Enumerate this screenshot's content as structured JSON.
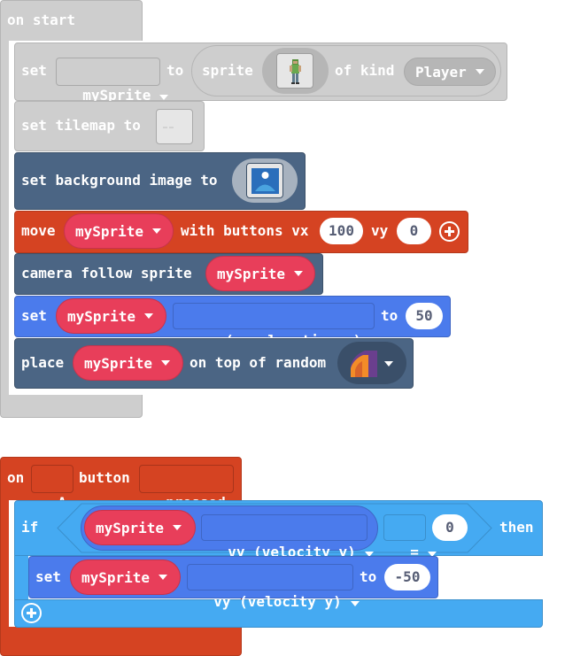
{
  "on_start": {
    "hat_label": "on start",
    "set_sprite": {
      "set": "set",
      "variable": "mySprite",
      "to": "to",
      "sprite": "sprite",
      "of_kind": "of kind",
      "kind": "Player"
    },
    "set_tilemap": {
      "label": "set tilemap to"
    },
    "set_background": {
      "label": "set background image to"
    },
    "move": {
      "move": "move",
      "variable": "mySprite",
      "with_buttons": "with buttons vx",
      "vx": "100",
      "vy_label": "vy",
      "vy": "0"
    },
    "camera": {
      "label": "camera follow sprite",
      "variable": "mySprite"
    },
    "set_ay": {
      "set": "set",
      "variable": "mySprite",
      "property": "ay (acceleration y)",
      "to": "to",
      "value": "50"
    },
    "place": {
      "place": "place",
      "variable": "mySprite",
      "label": "on top of random"
    }
  },
  "on_button": {
    "on": "on",
    "button": "A",
    "button_label": "button",
    "event": "pressed",
    "if_label": "if",
    "cond_variable": "mySprite",
    "cond_property": "vy (velocity y)",
    "operator": "=",
    "cond_value": "0",
    "then": "then",
    "set": "set",
    "set_variable": "mySprite",
    "set_property": "vy (velocity y)",
    "set_to": "to",
    "set_value": "-50"
  },
  "colors": {
    "disabled": "#cecece",
    "scene": "#4b6584",
    "controller": "#d54322",
    "sprites": "#4b7bec",
    "variable": "#e83e5a",
    "logic": "#45aaf2"
  }
}
